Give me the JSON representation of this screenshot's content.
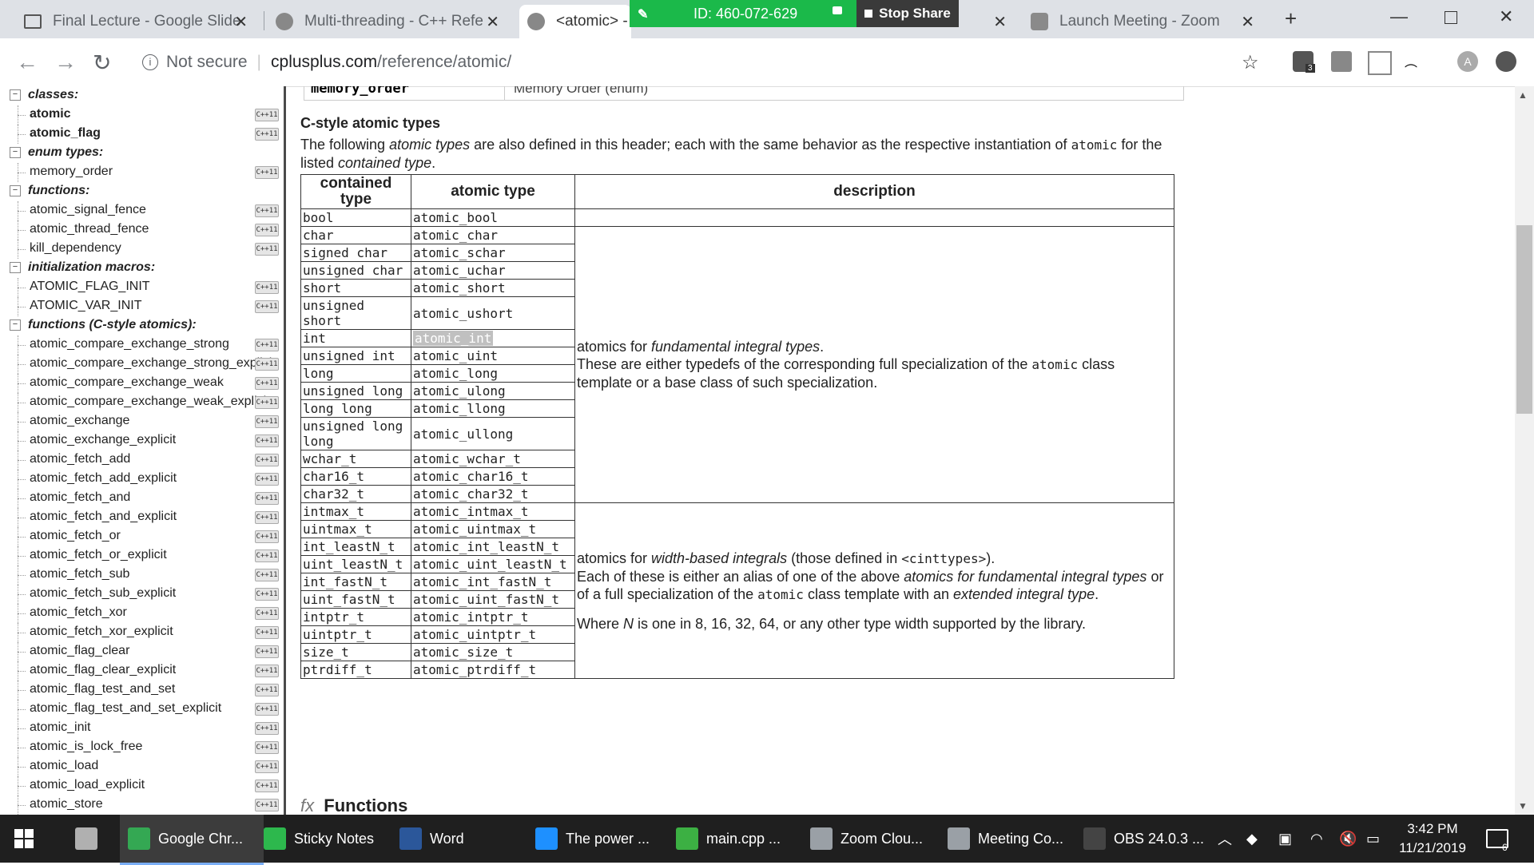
{
  "browser": {
    "tabs": [
      {
        "title": "Final Lecture - Google Slide",
        "active": false
      },
      {
        "title": "Multi-threading - C++ Refe",
        "active": false
      },
      {
        "title": "<atomic> -",
        "active": true
      },
      {
        "title": "",
        "active": false
      },
      {
        "title": "Launch Meeting - Zoom",
        "active": false
      }
    ],
    "new_tab": "+",
    "zoom_share": {
      "meeting_id": "ID: 460-072-629",
      "stop_label": "Stop Share"
    },
    "security_label": "Not secure",
    "url_host": "cplusplus.com",
    "url_path": "/reference/atomic/",
    "profile_initial": "A",
    "ext_badge": "3"
  },
  "sidebar": {
    "cpp_badge": "C++11",
    "groups": [
      {
        "header": "classes:",
        "items": [
          {
            "label": "atomic",
            "bold": true
          },
          {
            "label": "atomic_flag",
            "bold": true
          }
        ]
      },
      {
        "header": "enum types:",
        "items": [
          {
            "label": "memory_order",
            "bold": false
          }
        ]
      },
      {
        "header": "functions:",
        "items": [
          {
            "label": "atomic_signal_fence"
          },
          {
            "label": "atomic_thread_fence"
          },
          {
            "label": "kill_dependency"
          }
        ]
      },
      {
        "header": "initialization macros:",
        "items": [
          {
            "label": "ATOMIC_FLAG_INIT"
          },
          {
            "label": "ATOMIC_VAR_INIT"
          }
        ]
      },
      {
        "header": "functions (C-style atomics):",
        "items": [
          {
            "label": "atomic_compare_exchange_strong"
          },
          {
            "label": "atomic_compare_exchange_strong_explicit"
          },
          {
            "label": "atomic_compare_exchange_weak"
          },
          {
            "label": "atomic_compare_exchange_weak_explicit"
          },
          {
            "label": "atomic_exchange"
          },
          {
            "label": "atomic_exchange_explicit"
          },
          {
            "label": "atomic_fetch_add"
          },
          {
            "label": "atomic_fetch_add_explicit"
          },
          {
            "label": "atomic_fetch_and"
          },
          {
            "label": "atomic_fetch_and_explicit"
          },
          {
            "label": "atomic_fetch_or"
          },
          {
            "label": "atomic_fetch_or_explicit"
          },
          {
            "label": "atomic_fetch_sub"
          },
          {
            "label": "atomic_fetch_sub_explicit"
          },
          {
            "label": "atomic_fetch_xor"
          },
          {
            "label": "atomic_fetch_xor_explicit"
          },
          {
            "label": "atomic_flag_clear"
          },
          {
            "label": "atomic_flag_clear_explicit"
          },
          {
            "label": "atomic_flag_test_and_set"
          },
          {
            "label": "atomic_flag_test_and_set_explicit"
          },
          {
            "label": "atomic_init"
          },
          {
            "label": "atomic_is_lock_free"
          },
          {
            "label": "atomic_load"
          },
          {
            "label": "atomic_load_explicit"
          },
          {
            "label": "atomic_store"
          }
        ]
      }
    ]
  },
  "content": {
    "prev_row_left": "memory_order",
    "prev_row_right": "Memory Order (enum)",
    "section_title": "C-style atomic types",
    "intro_1": "The following ",
    "intro_em": "atomic types",
    "intro_2": " are also defined in this header; each with the same behavior as the respective instantiation of ",
    "intro_code": "atomic",
    "intro_3": " for the listed ",
    "intro_em2": "contained type",
    "intro_4": ".",
    "table": {
      "headers": [
        "contained type",
        "atomic type",
        "description"
      ],
      "rows": [
        [
          "bool",
          "atomic_bool"
        ],
        [
          "char",
          "atomic_char"
        ],
        [
          "signed char",
          "atomic_schar"
        ],
        [
          "unsigned char",
          "atomic_uchar"
        ],
        [
          "short",
          "atomic_short"
        ],
        [
          "unsigned short",
          "atomic_ushort"
        ],
        [
          "int",
          "atomic_int"
        ],
        [
          "unsigned int",
          "atomic_uint"
        ],
        [
          "long",
          "atomic_long"
        ],
        [
          "unsigned long",
          "atomic_ulong"
        ],
        [
          "long long",
          "atomic_llong"
        ],
        [
          "unsigned long long",
          "atomic_ullong"
        ],
        [
          "wchar_t",
          "atomic_wchar_t"
        ],
        [
          "char16_t",
          "atomic_char16_t"
        ],
        [
          "char32_t",
          "atomic_char32_t"
        ],
        [
          "intmax_t",
          "atomic_intmax_t"
        ],
        [
          "uintmax_t",
          "atomic_uintmax_t"
        ],
        [
          "int_leastN_t",
          "atomic_int_leastN_t"
        ],
        [
          "uint_leastN_t",
          "atomic_uint_leastN_t"
        ],
        [
          "int_fastN_t",
          "atomic_int_fastN_t"
        ],
        [
          "uint_fastN_t",
          "atomic_uint_fastN_t"
        ],
        [
          "intptr_t",
          "atomic_intptr_t"
        ],
        [
          "uintptr_t",
          "atomic_uintptr_t"
        ],
        [
          "size_t",
          "atomic_size_t"
        ],
        [
          "ptrdiff_t",
          "atomic_ptrdiff_t"
        ]
      ],
      "desc_fund_1": "atomics for ",
      "desc_fund_em": "fundamental integral types",
      "desc_fund_2": ".",
      "desc_fund_3": "These are either typedefs of the corresponding full specialization of the ",
      "desc_fund_code": "atomic",
      "desc_fund_4": " class template or a base class of such specialization.",
      "desc_width_1": "atomics for ",
      "desc_width_em": "width-based integrals",
      "desc_width_2": " (those defined in ",
      "desc_width_code": "<cinttypes>",
      "desc_width_3": ").",
      "desc_width_4": "Each of these is either an alias of one of the above ",
      "desc_width_em2": "atomics for fundamental integral types",
      "desc_width_5": " or of a full specialization of the ",
      "desc_width_code2": "atomic",
      "desc_width_6": " class template with an ",
      "desc_width_em3": "extended integral type",
      "desc_width_7": ".",
      "desc_width_8a": "Where ",
      "desc_width_8N": "N",
      "desc_width_8b": " is one in 8, 16, 32, 64, or any other type width supported by the library."
    },
    "functions_label": "Functions",
    "functions_fx": "fx"
  },
  "taskbar": {
    "items": [
      {
        "label": "",
        "color": "#b0b0b0"
      },
      {
        "label": "Google Chr...",
        "color": "#34a853",
        "active": true
      },
      {
        "label": "Sticky Notes",
        "color": "#2db84d"
      },
      {
        "label": "Word",
        "color": "#2b579a"
      },
      {
        "label": "The power ...",
        "color": "#1e90ff"
      },
      {
        "label": "main.cpp ...",
        "color": "#3cb043"
      },
      {
        "label": "Zoom Clou...",
        "color": "#9aa0a6"
      },
      {
        "label": "Meeting Co...",
        "color": "#9aa0a6"
      },
      {
        "label": "OBS 24.0.3 ...",
        "color": "#444"
      }
    ],
    "time": "3:42 PM",
    "date": "11/21/2019",
    "notif_count": "6"
  }
}
